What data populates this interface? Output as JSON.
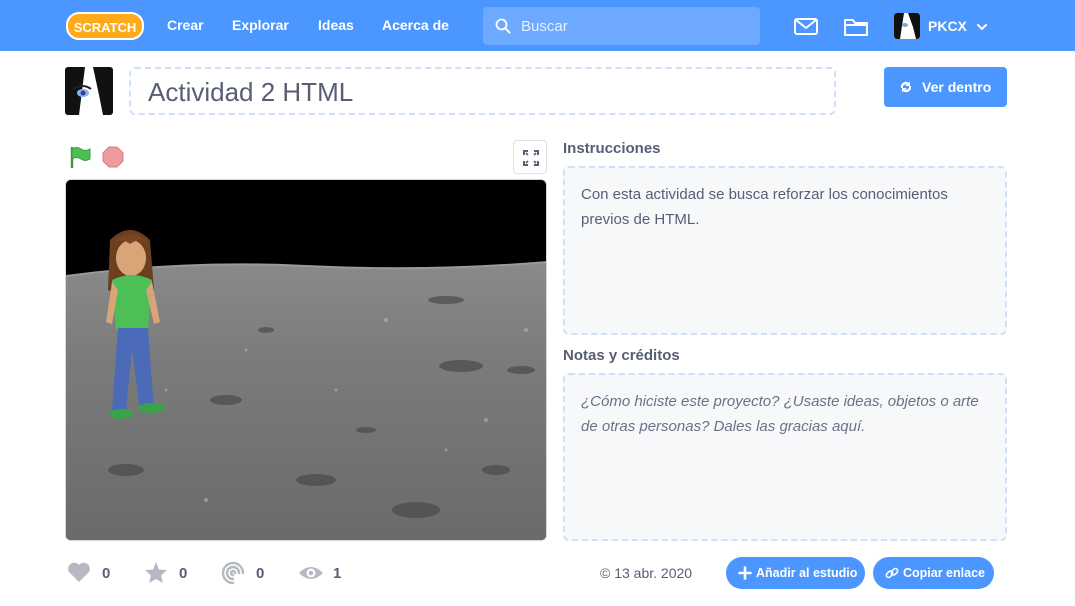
{
  "nav": {
    "logo_text": "SCRATCH",
    "links": [
      "Crear",
      "Explorar",
      "Ideas",
      "Acerca de"
    ],
    "search_placeholder": "Buscar",
    "username": "PKCX"
  },
  "project": {
    "title": "Actividad 2 HTML",
    "see_inside_label": "Ver dentro"
  },
  "instructions": {
    "heading": "Instrucciones",
    "text": "Con esta actividad se busca reforzar los conocimientos previos de HTML."
  },
  "notes": {
    "heading": "Notas y créditos",
    "placeholder": "¿Cómo hiciste este proyecto? ¿Usaste ideas, objetos o arte de otras personas? Dales las gracias aquí."
  },
  "stats": {
    "loves": "0",
    "favorites": "0",
    "remixes": "0",
    "views": "1"
  },
  "date": "© 13 abr. 2020",
  "buttons": {
    "add_to_studio": "Añadir al estudio",
    "copy_link": "Copiar enlace"
  },
  "icons": [
    "scratch-logo",
    "search-icon",
    "messages-icon",
    "my-stuff-icon",
    "avatar",
    "chevron-down-icon",
    "see-inside-icon",
    "green-flag-icon",
    "stop-icon",
    "fullscreen-icon",
    "heart-icon",
    "star-icon",
    "remix-icon",
    "views-icon",
    "plus-icon",
    "link-icon"
  ],
  "colors": {
    "primary": "#4c97ff",
    "text": "#575e75",
    "flag": "#4cbf56",
    "stop": "#ec9c9c"
  }
}
